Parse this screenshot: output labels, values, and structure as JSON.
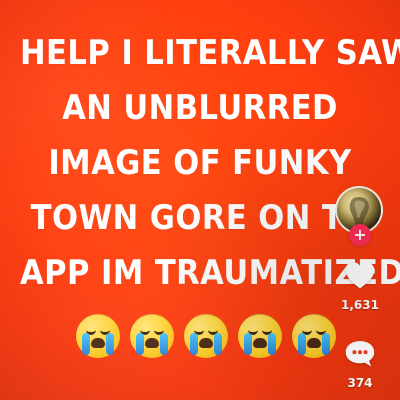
{
  "video": {
    "overlay_lines": [
      "HELP I LITERALLY SAW",
      "AN UNBLURRED",
      "IMAGE OF FUNKY",
      "TOWN GORE ON TH",
      "APP IM TRAUMATIZED"
    ],
    "emojis": [
      "loudly-crying-face",
      "loudly-crying-face",
      "loudly-crying-face",
      "loudly-crying-face",
      "loudly-crying-face"
    ]
  },
  "right_rail": {
    "avatar_icon": "creator-avatar",
    "follow_icon": "plus-icon",
    "follow_color": "#fe2c55",
    "like": {
      "icon": "heart-icon",
      "count": "1,631"
    },
    "comments": {
      "icon": "comment-icon",
      "count": "374"
    }
  },
  "colors": {
    "background": "#ff4b12",
    "text": "#ffffff"
  }
}
